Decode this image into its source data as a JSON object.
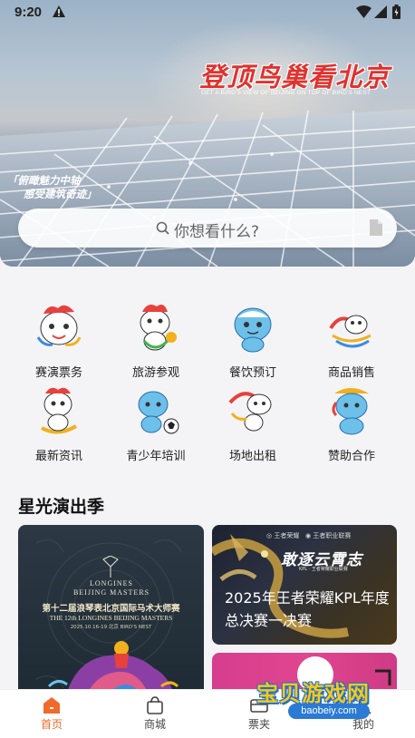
{
  "status_bar": {
    "time": "9:20"
  },
  "hero": {
    "title": "登顶鸟巢看北京",
    "subtitle": "GET A BIRD'S VIEW OF BEIJING ON TOP OF BIRD'S NEST",
    "slogan_line1": "「俯瞰魅力中轴",
    "slogan_line2": "感受建筑奇迹」"
  },
  "search": {
    "placeholder": "你想看什么?"
  },
  "categories": [
    {
      "label": "赛演票务",
      "icon": "mascot-ticket-icon"
    },
    {
      "label": "旅游参观",
      "icon": "mascot-tour-icon"
    },
    {
      "label": "餐饮预订",
      "icon": "mascot-dining-icon"
    },
    {
      "label": "商品销售",
      "icon": "mascot-shop-icon"
    },
    {
      "label": "最新资讯",
      "icon": "mascot-news-icon"
    },
    {
      "label": "青少年培训",
      "icon": "mascot-training-icon"
    },
    {
      "label": "场地出租",
      "icon": "mascot-venue-icon"
    },
    {
      "label": "赞助合作",
      "icon": "mascot-sponsor-icon"
    }
  ],
  "section": {
    "title": "星光演出季"
  },
  "cards": {
    "longines": {
      "brand_line1": "LONGINES",
      "brand_line2": "BEIJING MASTERS",
      "title_cn": "第十二届浪琴表北京国际马术大师赛",
      "title_en": "THE 12th LONGINES BEIJING MASTERS",
      "date": "2025.10.16-19  北京 BIRD'S NEST"
    },
    "kpl": {
      "brand": "敢逐云霄志",
      "small": "KPL · 王者荣耀职业联赛",
      "label": "2025年王者荣耀KPL年度总决赛一决赛"
    }
  },
  "bottom_nav": [
    {
      "label": "首页",
      "icon": "home-icon",
      "active": true
    },
    {
      "label": "商城",
      "icon": "shopping-bag-icon",
      "active": false
    },
    {
      "label": "票夹",
      "icon": "ticket-wallet-icon",
      "active": false
    },
    {
      "label": "我的",
      "icon": "profile-icon",
      "active": false
    }
  ],
  "watermark": {
    "text": "宝贝游戏网",
    "url": "baobeiy.com"
  },
  "colors": {
    "accent": "#f06a2a",
    "hero_title": "#e0322e"
  }
}
